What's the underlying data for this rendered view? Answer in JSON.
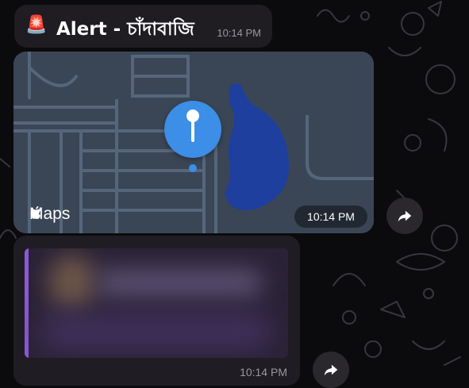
{
  "alert": {
    "emoji": "🚨",
    "title": "Alert - চাঁদাবাজি",
    "time": "10:14 PM"
  },
  "map_message": {
    "logo_text": "Maps",
    "time": "10:14 PM",
    "colors": {
      "land": "#3a4656",
      "roads": "#56667a",
      "water": "#1e3f9e",
      "pin": "#3c8ee6"
    }
  },
  "preview_message": {
    "time": "10:14 PM",
    "accent": "#8c5ad8"
  },
  "icons": {
    "forward": "forward-arrow-icon",
    "pin": "location-pin-icon",
    "apple": "apple-icon"
  }
}
